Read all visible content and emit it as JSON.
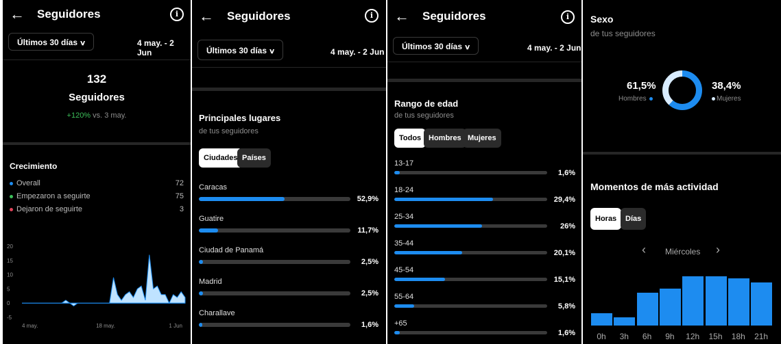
{
  "panel1": {
    "title": "Seguidores",
    "range": "Últimos 30 días",
    "dates": "4 may. - 2 Jun",
    "followers_count": "132",
    "followers_label": "Seguidores",
    "change": "+120%",
    "change_suffix": " vs. 3 may.",
    "growth_title": "Crecimiento",
    "legend": [
      {
        "label": "Overall",
        "value": "72",
        "color": "#1d8cf0"
      },
      {
        "label": "Empezaron a seguirte",
        "value": "75",
        "color": "#3cbf5a"
      },
      {
        "label": "Dejaron de seguirte",
        "value": "3",
        "color": "#e0445a"
      }
    ],
    "chart_data": {
      "type": "area",
      "x_tick_labels": [
        "4 may.",
        "18 may.",
        "1 Jun"
      ],
      "y_ticks": [
        "20",
        "15",
        "10",
        "5",
        "0",
        "-5"
      ],
      "ylim": [
        -5,
        20
      ],
      "values": [
        0,
        0,
        0,
        0,
        0,
        0,
        0,
        0,
        0,
        0,
        0,
        1,
        0,
        -1,
        0,
        0,
        0,
        0,
        0,
        0,
        0,
        0,
        0,
        9,
        3,
        1,
        3,
        4,
        2,
        5,
        6,
        1,
        17,
        5,
        6,
        3,
        3,
        0,
        3,
        2,
        4,
        2
      ]
    }
  },
  "panel2": {
    "title": "Seguidores",
    "range": "Últimos 30 días",
    "dates": "4 may. - 2 Jun",
    "section_title": "Principales lugares",
    "section_sub": "de tus seguidores",
    "tabs": [
      "Ciudades",
      "Países"
    ],
    "rows": [
      {
        "label": "Caracas",
        "pct": "52,9%",
        "value": 52.9
      },
      {
        "label": "Guatire",
        "pct": "11,7%",
        "value": 11.7
      },
      {
        "label": "Ciudad de Panamá",
        "pct": "2,5%",
        "value": 2.5
      },
      {
        "label": "Madrid",
        "pct": "2,5%",
        "value": 2.5
      },
      {
        "label": "Charallave",
        "pct": "1,6%",
        "value": 1.6
      }
    ]
  },
  "panel3": {
    "title": "Seguidores",
    "range": "Últimos 30 días",
    "dates": "4 may. - 2 Jun",
    "section_title": "Rango de edad",
    "section_sub": "de tus seguidores",
    "tabs": [
      "Todos",
      "Hombres",
      "Mujeres"
    ],
    "rows": [
      {
        "label": "13-17",
        "pct": "1,6%",
        "value": 1.6
      },
      {
        "label": "18-24",
        "pct": "29,4%",
        "value": 29.4
      },
      {
        "label": "25-34",
        "pct": "26%",
        "value": 26
      },
      {
        "label": "35-44",
        "pct": "20,1%",
        "value": 20.1
      },
      {
        "label": "45-54",
        "pct": "15,1%",
        "value": 15.1
      },
      {
        "label": "55-64",
        "pct": "5,8%",
        "value": 5.8
      },
      {
        "label": "+65",
        "pct": "1,6%",
        "value": 1.6
      }
    ]
  },
  "panel4": {
    "sex_title": "Sexo",
    "sex_sub": "de tus seguidores",
    "men_pct": "61,5%",
    "men_label": "Hombres",
    "women_pct": "38,4%",
    "women_label": "Mujeres",
    "men_value": 61.5,
    "women_value": 38.4,
    "men_color": "#1d8cf0",
    "women_color": "#d8ecff",
    "activity_title": "Momentos de más actividad",
    "tabs": [
      "Horas",
      "Días"
    ],
    "day": "Miércoles",
    "chart_data": {
      "type": "bar",
      "categories": [
        "0h",
        "3h",
        "6h",
        "9h",
        "12h",
        "15h",
        "18h",
        "21h"
      ],
      "values": [
        18,
        12,
        48,
        54,
        72,
        72,
        69,
        63
      ],
      "ylim": [
        0,
        80
      ]
    }
  }
}
